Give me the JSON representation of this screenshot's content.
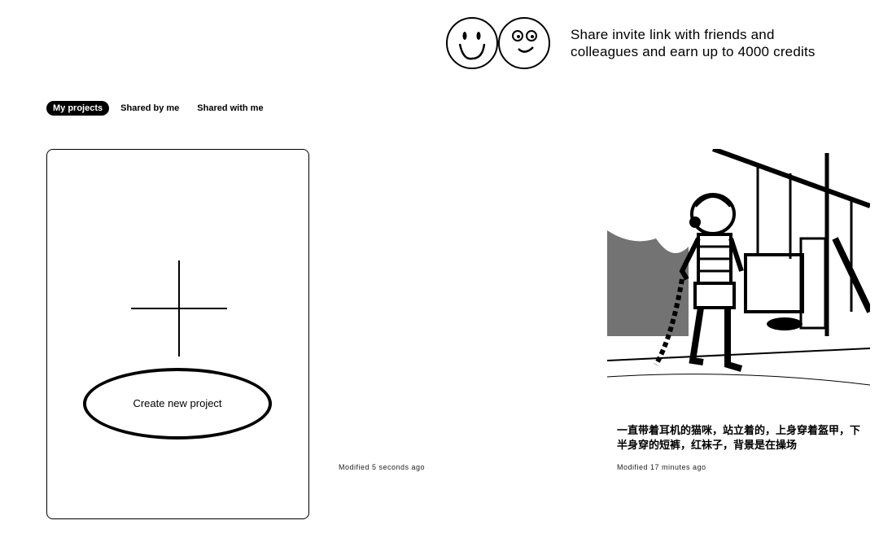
{
  "invite": {
    "text_line1": "Share invite link with friends and",
    "text_line2": "colleagues and earn up to 4000 credits",
    "icons": [
      "smiley-face-icon",
      "winking-face-icon"
    ]
  },
  "tabs": [
    {
      "label": "My projects",
      "active": true
    },
    {
      "label": "Shared by me",
      "active": false
    },
    {
      "label": "Shared with me",
      "active": false
    }
  ],
  "create_card": {
    "label": "Create new project",
    "icon": "plus-icon"
  },
  "projects": [
    {
      "modified": "Modified 5 seconds ago"
    },
    {
      "caption": "一直带着耳机的猫咪，站立着的，上身穿着盔甲，下半身穿的短裤，红袜子，背景是在操场",
      "modified": "Modified 17 minutes ago"
    }
  ]
}
